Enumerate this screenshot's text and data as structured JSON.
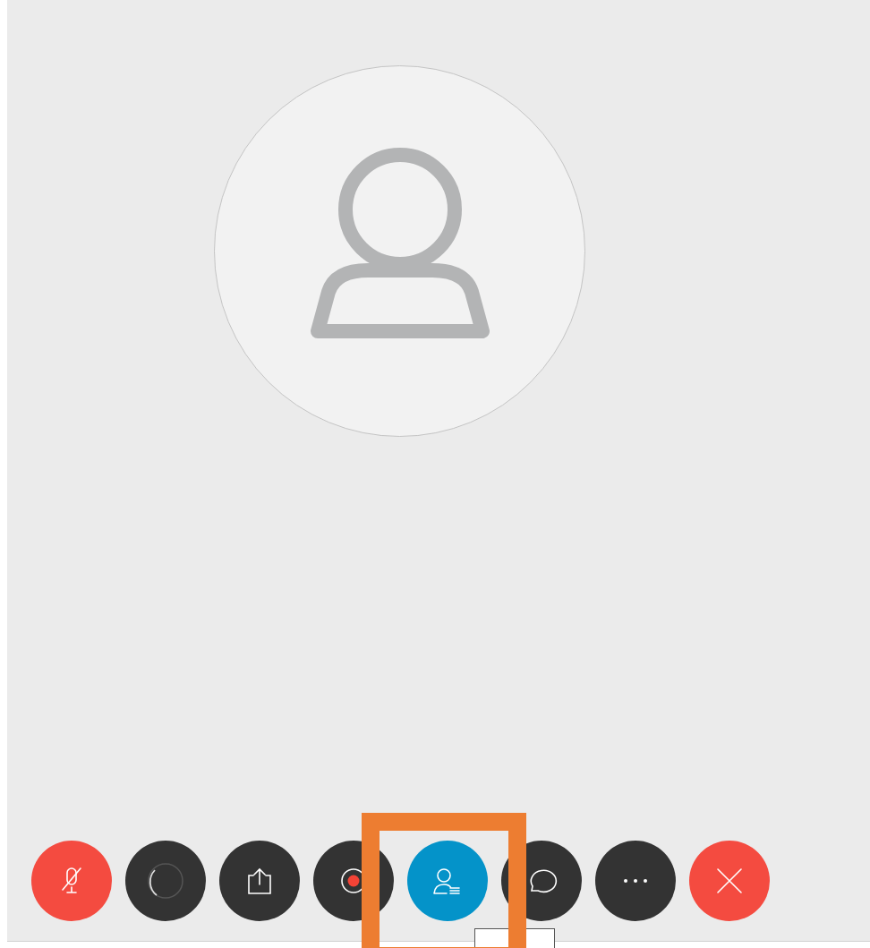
{
  "toolbar": {
    "buttons": [
      {
        "kind": "mute",
        "muted": true,
        "selected": false
      },
      {
        "kind": "video",
        "selected": false
      },
      {
        "kind": "share",
        "selected": false
      },
      {
        "kind": "record",
        "selected": false
      },
      {
        "kind": "participants",
        "selected": true
      },
      {
        "kind": "chat",
        "selected": false
      },
      {
        "kind": "more",
        "selected": false
      },
      {
        "kind": "leave",
        "selected": false
      }
    ]
  }
}
